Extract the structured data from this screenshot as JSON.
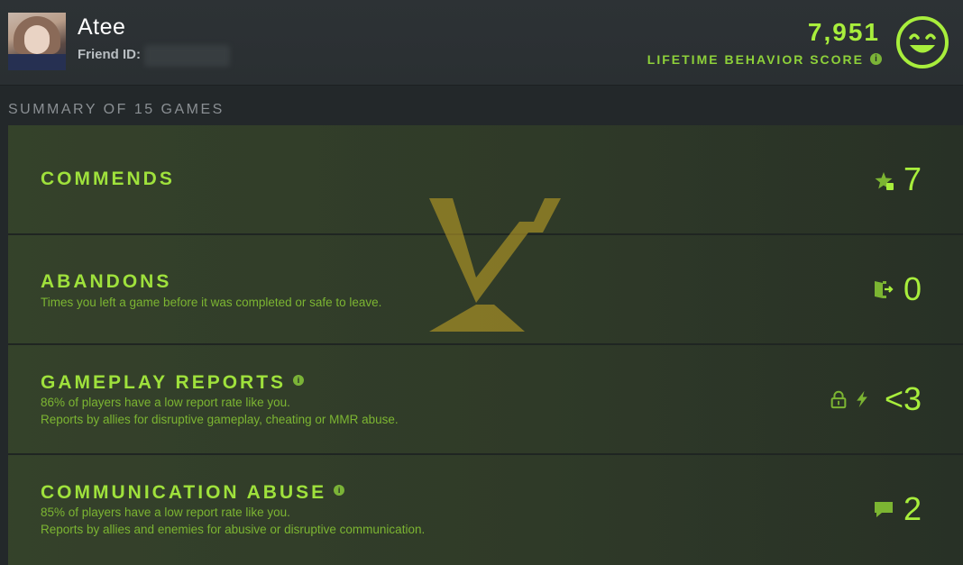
{
  "profile": {
    "name": "Atee",
    "friend_id_label": "Friend ID:"
  },
  "behavior": {
    "score": "7,951",
    "label": "LIFETIME BEHAVIOR SCORE",
    "info_glyph": "i"
  },
  "summary": {
    "title": "SUMMARY OF 15 GAMES"
  },
  "rows": [
    {
      "title": "COMMENDS",
      "desc": [],
      "value": "7",
      "icon": "star-thumb-icon"
    },
    {
      "title": "ABANDONS",
      "desc": [
        "Times you left a game before it was completed or safe to leave."
      ],
      "value": "0",
      "icon": "exit-door-icon"
    },
    {
      "title": "GAMEPLAY REPORTS",
      "desc": [
        "86% of players have a low report rate like you.",
        "Reports by allies for disruptive gameplay, cheating or MMR abuse."
      ],
      "value": "<3",
      "icon": "lock-lightning-icon"
    },
    {
      "title": "COMMUNICATION ABUSE",
      "desc": [
        "85% of players have a low report rate like you.",
        "Reports by allies and enemies for abusive or disruptive communication."
      ],
      "value": "2",
      "icon": "chat-bubble-icon"
    }
  ],
  "colors": {
    "accent": "#a8ee3c",
    "accent_dim": "#7cb532",
    "background": "#23282a",
    "logo": "#c9a826"
  }
}
